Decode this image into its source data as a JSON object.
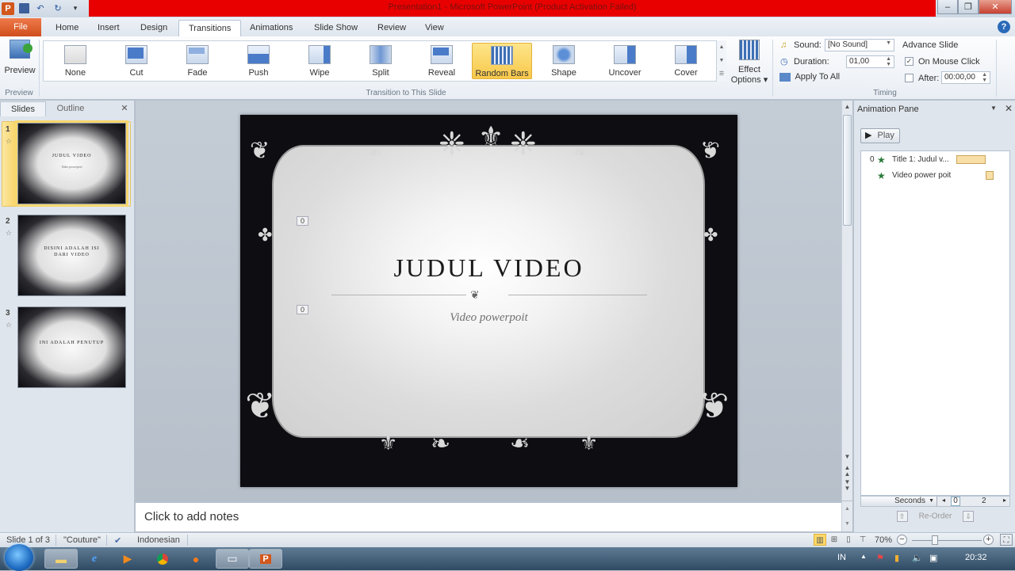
{
  "window": {
    "title": "Presentation1  -  Microsoft PowerPoint (Product Activation Failed)",
    "minimize": "–",
    "restore": "❐",
    "close": "✕"
  },
  "qat": {
    "app_icon": "P",
    "save_icon": "save-icon",
    "undo_icon": "↶",
    "redo_icon": "↻",
    "customize_icon": "▾"
  },
  "tabs": [
    {
      "label": "File"
    },
    {
      "label": "Home"
    },
    {
      "label": "Insert"
    },
    {
      "label": "Design"
    },
    {
      "label": "Transitions",
      "active": true
    },
    {
      "label": "Animations"
    },
    {
      "label": "Slide Show"
    },
    {
      "label": "Review"
    },
    {
      "label": "View"
    }
  ],
  "help_icon": "?",
  "minimize_ribbon_icon": "⌃",
  "ribbon": {
    "preview": {
      "label": "Preview",
      "group": "Preview"
    },
    "transitions_group": "Transition to This Slide",
    "transitions": [
      {
        "label": "None"
      },
      {
        "label": "Cut"
      },
      {
        "label": "Fade"
      },
      {
        "label": "Push"
      },
      {
        "label": "Wipe"
      },
      {
        "label": "Split"
      },
      {
        "label": "Reveal"
      },
      {
        "label": "Random Bars",
        "selected": true
      },
      {
        "label": "Shape"
      },
      {
        "label": "Uncover"
      },
      {
        "label": "Cover"
      }
    ],
    "effect_options": {
      "line1": "Effect",
      "line2": "Options ▾"
    },
    "timing": {
      "group": "Timing",
      "sound_label": "Sound:",
      "sound_value": "[No Sound]",
      "duration_label": "Duration:",
      "duration_value": "01,00",
      "apply_all": "Apply To All",
      "advance_title": "Advance Slide",
      "on_mouse_click": "On Mouse Click",
      "on_mouse_click_checked": true,
      "after_label": "After:",
      "after_checked": false,
      "after_value": "00:00,00"
    }
  },
  "left_pane": {
    "tabs": [
      "Slides",
      "Outline"
    ],
    "close": "✕",
    "slides": [
      {
        "num": "1",
        "title": "JUDUL VIDEO",
        "sub": "Video powerpoit",
        "selected": true
      },
      {
        "num": "2",
        "title": "DISINI ADALAH ISI DARI VIDEO",
        "sub": ""
      },
      {
        "num": "3",
        "title": "INI ADALAH PENUTUP",
        "sub": ""
      }
    ]
  },
  "slide": {
    "title": "JUDUL VIDEO",
    "subtitle": "Video powerpoit",
    "anim_tags": [
      "0",
      "0"
    ]
  },
  "notes": {
    "placeholder": "Click to add notes"
  },
  "animation_pane": {
    "title": "Animation Pane",
    "play": "Play",
    "items": [
      {
        "index": "0",
        "label": "Title 1: Judul v..."
      },
      {
        "index": "",
        "label": "Video power poit"
      }
    ],
    "timeline": {
      "unit": "Seconds",
      "start": "0",
      "end": "2"
    },
    "reorder": "Re-Order"
  },
  "status": {
    "slide": "Slide 1 of 3",
    "theme": "\"Couture\"",
    "language": "Indonesian",
    "zoom": "70%",
    "zoom_level_percent": 70
  },
  "taskbar": {
    "lang": "IN",
    "time": "20:32"
  }
}
